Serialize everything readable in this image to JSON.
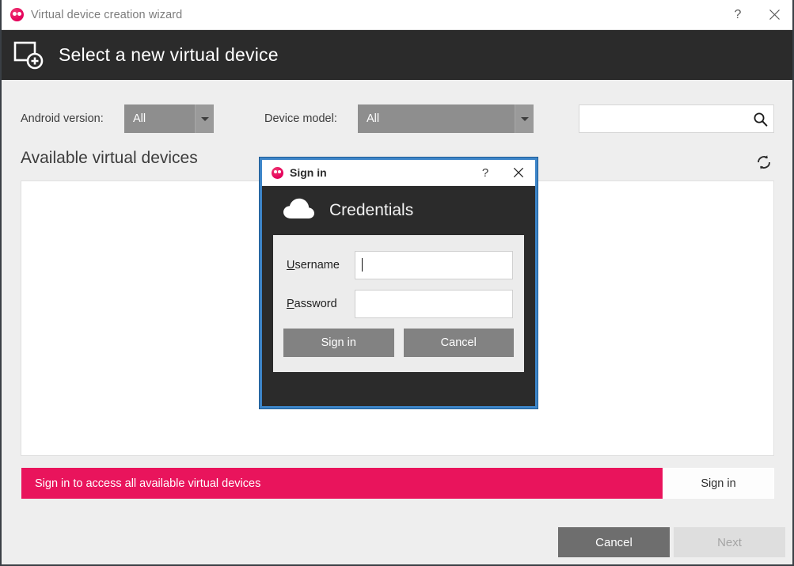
{
  "window": {
    "title": "Virtual device creation wizard",
    "app_icon": "genymotion-logo-icon",
    "help_label": "?",
    "close_label": "close-icon"
  },
  "header": {
    "icon": "new-virtual-device-icon",
    "title": "Select a new virtual device"
  },
  "filters": {
    "android_version": {
      "label": "Android version:",
      "value": "All",
      "arrow_icon": "chevron-down-icon"
    },
    "device_model": {
      "label": "Device model:",
      "value": "All",
      "arrow_icon": "chevron-down-icon"
    },
    "search": {
      "value": "",
      "placeholder": "",
      "icon": "search-icon"
    }
  },
  "section": {
    "title": "Available virtual devices",
    "refresh_icon": "refresh-icon",
    "devices": []
  },
  "banner": {
    "message": "Sign in to access all available virtual devices",
    "button_label": "Sign in",
    "color": "#e9145c"
  },
  "footer": {
    "cancel_label": "Cancel",
    "next_label": "Next",
    "next_disabled": true
  },
  "dialog": {
    "icon": "genymotion-logo-icon",
    "title": "Sign in",
    "help_label": "?",
    "close_label": "close-icon",
    "header": {
      "icon": "cloud-icon",
      "title": "Credentials"
    },
    "fields": {
      "username": {
        "label_accel": "U",
        "label_rest": "sername",
        "value": "",
        "placeholder": ""
      },
      "password": {
        "label_accel": "P",
        "label_rest": "assword",
        "value": "",
        "placeholder": ""
      }
    },
    "buttons": {
      "signin_label": "Sign in",
      "cancel_label": "Cancel"
    },
    "border_color": "#3d85c8"
  }
}
